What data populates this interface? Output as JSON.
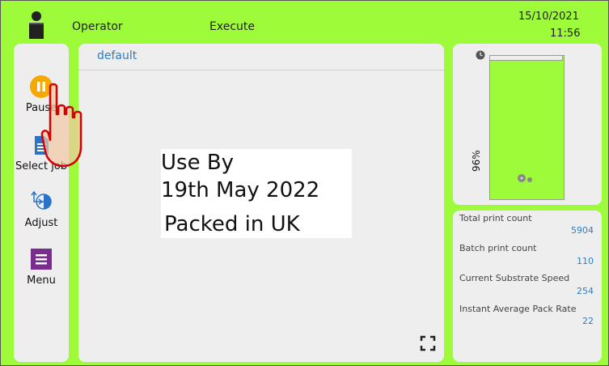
{
  "header": {
    "role": "Operator",
    "mode": "Execute",
    "date": "15/10/2021",
    "time": "11:56"
  },
  "sidebar": {
    "items": [
      {
        "label": "Pause",
        "icon": "pause-icon",
        "color": "#f5a800"
      },
      {
        "label": "Select job",
        "icon": "select-job-icon",
        "color": "#2b73c9"
      },
      {
        "label": "Adjust",
        "icon": "adjust-icon",
        "color": "#2b73c9"
      },
      {
        "label": "Menu",
        "icon": "menu-icon",
        "color": "#7b2d8f"
      }
    ]
  },
  "job": {
    "name": "default",
    "preview_lines": [
      "Use By",
      "19th May 2022",
      "Packed in UK"
    ]
  },
  "ink": {
    "level_percent": 96,
    "level_label": "96%"
  },
  "stats": [
    {
      "label": "Total print count",
      "value": "5904"
    },
    {
      "label": "Batch print count",
      "value": "110"
    },
    {
      "label": "Current Substrate Speed",
      "value": "254"
    },
    {
      "label": "Instant Average Pack Rate",
      "value": "22"
    }
  ],
  "colors": {
    "background": "#9dfb3a",
    "panel": "#eeeeee",
    "accent_text": "#2e7dbf"
  }
}
